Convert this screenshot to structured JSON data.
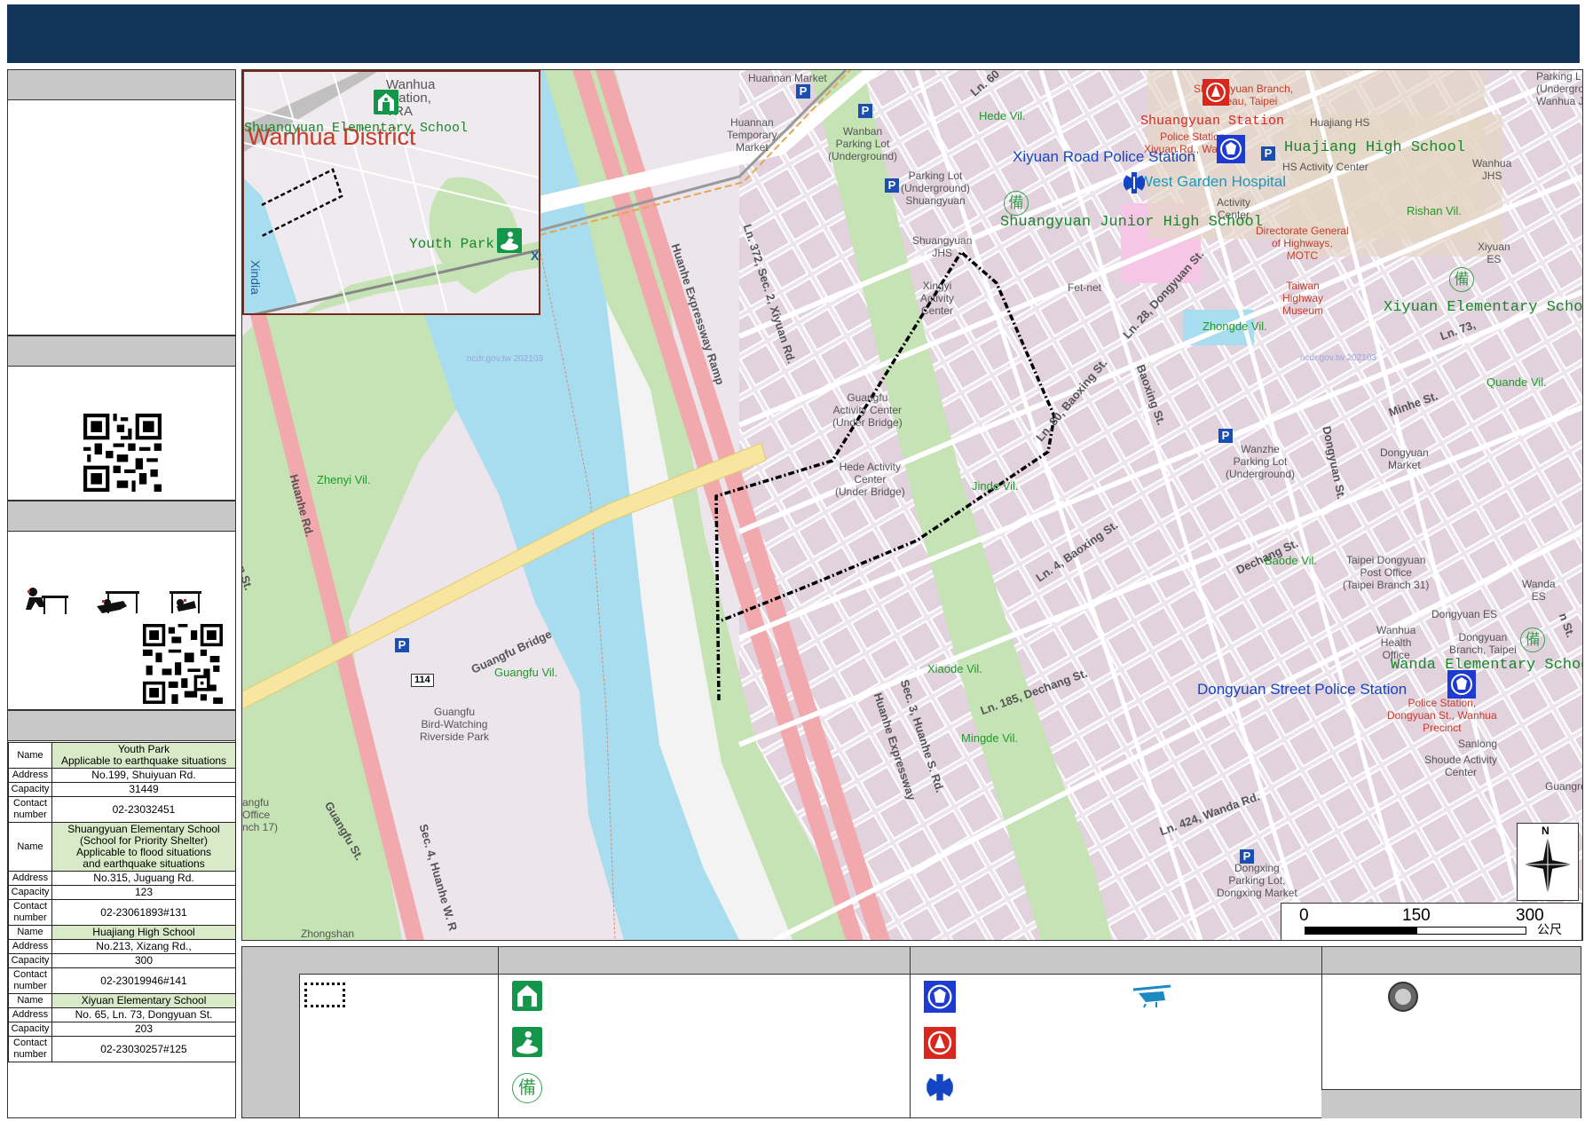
{
  "map": {
    "districts": {
      "inset": "Wanhua District"
    },
    "watermarks": [
      "ncdr.gov.tw 202103",
      "ncdr.gov.tw 202103"
    ],
    "inset_labels": {
      "station": "Wanhua\nStation,\nTRA",
      "school": "Shuangyuan Elementary School",
      "park": "Youth Park",
      "river_left": "Xindia",
      "xi": "Xi"
    },
    "shelters_on_map": {
      "shuangyuan_station": "Shuangyuan Station",
      "xiyuan_police": "Xiyuan Road Police Station",
      "huajiang_hs": "Huajiang High School",
      "west_garden": "West Garden Hospital",
      "shuangyuan_jhs": "Shuangyuan Junior High School",
      "xiyuan_es": "Xiyuan Elementary School",
      "wanda_es": "Wanda Elementary School",
      "dongyuan_police": "Dongyuan Street Police Station"
    },
    "villages": {
      "hede": "Hede Vil.",
      "rishan": "Rishan Vil.",
      "zhongde": "Zhongde Vil.",
      "quande": "Quande Vil.",
      "jinde": "Jinde Vil.",
      "baode": "Baode Vil.",
      "zhenyi": "Zhenyi Vil.",
      "guangfu": "Guangfu Vil.",
      "xiaode": "Xiaode Vil.",
      "mingde": "Mingde Vil."
    },
    "pois": {
      "huannan_market": "Huannan Market",
      "huannan_temp": "Huannan\nTemporary\nMarket",
      "wanban_parking": "Wanban\nParking Lot\n(Underground)",
      "parking_ug": "Parking Lot\n(Underground)\nShuangyuan",
      "shuangyuan_jhs_small": "Shuangyuan\nJHS",
      "xingyi": "Xingyi\nActivity\nCenter",
      "guangfu_ac": "Guangfu\nActivity Center\n(Under Bridge)",
      "hede_ac": "Hede Activity\nCenter\n(Under Bridge)",
      "chtnet": "Fet-net",
      "huajiang_hs_small": "Huajiang HS",
      "hs_activity": "HS Activity Center",
      "activity_center": "Activity\nCenter",
      "shuangyuan_branch": "Shuangyuan Branch,\nBureau, Taipei",
      "shuangyuan_police_small": "Police Station\nXiyuan Rd., Wanhua",
      "directorate": "Directorate General\nof Highways,\nMOTC",
      "highway_museum": "Taiwan\nHighway\nMuseum",
      "wanhua_jhs": "Wanhua\nJHS",
      "xiyuan_es_small": "Xiyuan\nES",
      "parking_top_right": "Parking L\n(Undergrou\nWanhua J",
      "wanzhe": "Wanzhe\nParking Lot\n(Underground)",
      "dongyuan_market": "Dongyuan\nMarket",
      "post_office": "Taipei Dongyuan\nPost Office\n(Taipei Branch 31)",
      "wanda_es_small": "Wanda\nES",
      "dongyuan_es": "Dongyuan ES",
      "wanhua_health": "Wanhua\nHealth\nOffice",
      "dongyuan_branch": "Dongyuan\nBranch, Taipei",
      "dongyuan_police_small": "Police Station,\nDongyuan St., Wanhua\nPrecinct",
      "sanlong": "Sanlong",
      "shoude": "Shoude Activity\nCenter",
      "guangre": "Guangre",
      "dongxing": "Dongxing\nParking Lot,\nDongxing Market",
      "birdwatching": "Guangfu\nBird-Watching\nRiverside Park",
      "guangfu_office": "angfu\nOffice\nnch 17)",
      "zhongshan": "Zhongshan"
    },
    "roads": {
      "ln60": "Ln. 60",
      "ln372": "Ln. 372, Sec. 2, Xiyuan Rd.",
      "huanhe_ramp": "Huanhe Expressway Ramp",
      "huanhe_rd": "Huanhe Rd.",
      "guangfu_bridge": "Guangfu Bridge",
      "route114": "114",
      "ln28": "Ln. 28, Dongyuan St.",
      "ln80": "Ln. 80, Baoxing St.",
      "baoxing": "Baoxing St.",
      "dongyuan_st": "Dongyuan St.",
      "minhe": "Minhe St.",
      "ln73": "Ln. 73,",
      "dechang": "Dechang St.",
      "ln185": "Ln. 185, Dechang St.",
      "baoxing2": "Ln. 4, Baoxing St.",
      "huanhe_s": "Sec. 3, Huanhe S. Rd.",
      "huanhe_exp": "Huanhe Expressway",
      "ln424": "Ln. 424, Wanda Rd.",
      "huanhe_w": "Sec. 4, Huanhe W. R",
      "guangfu_st": "Guangfu St.",
      "an_st": "an St.",
      "st_tr": "n St."
    },
    "scale": {
      "zero": "0",
      "mid": "150",
      "max": "300",
      "unit": "公尺"
    },
    "compass": "N",
    "bei": "備"
  },
  "shelters": [
    {
      "name_label": "Name",
      "name": "Youth Park\nApplicable to earthquake situations",
      "addr_label": "Address",
      "address": "No.199, Shuiyuan Rd.",
      "cap_label": "Capacity",
      "capacity": "31449",
      "contact_label": "Contact\nnumber",
      "contact": "02-23032451"
    },
    {
      "name_label": "Name",
      "name": "Shuangyuan Elementary School\n(School for Priority Shelter)\nApplicable to flood situations\nand earthquake situations",
      "addr_label": "Address",
      "address": "No.315, Juguang Rd.",
      "cap_label": "Capacity",
      "capacity": "123",
      "contact_label": "Contact\nnumber",
      "contact": "02-23061893#131"
    },
    {
      "name_label": "Name",
      "name": "Huajiang High School",
      "addr_label": "Address",
      "address": "No.213, Xizang Rd.,",
      "cap_label": "Capacity",
      "capacity": "300",
      "contact_label": "Contact\nnumber",
      "contact": "02-23019946#141"
    },
    {
      "name_label": "Name",
      "name": "Xiyuan Elementary School",
      "addr_label": "Address",
      "address": "No. 65, Ln. 73, Dongyuan St.",
      "cap_label": "Capacity",
      "capacity": "203",
      "contact_label": "Contact\nnumber",
      "contact": "02-23030257#125"
    }
  ],
  "colors": {
    "title_bar": "#12355b",
    "river": "#a8dcef",
    "park": "#c5e3b4",
    "road": "#f2a9ad",
    "land": "#ece5ec",
    "block": "#e2d2de"
  }
}
